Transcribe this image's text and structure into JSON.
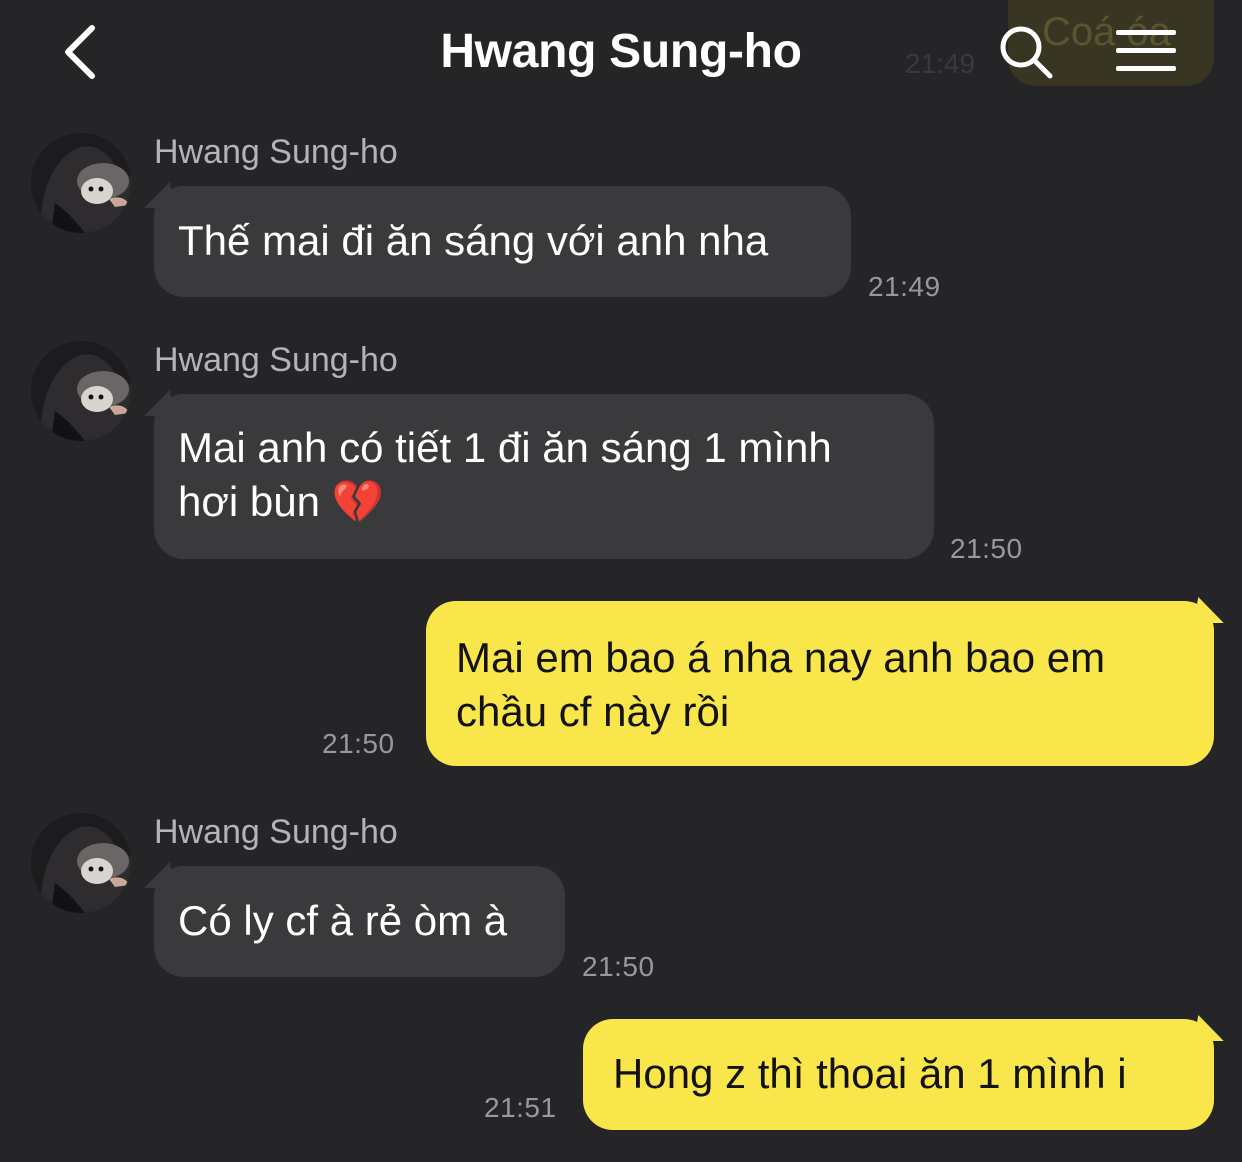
{
  "header": {
    "title": "Hwang Sung-ho"
  },
  "previous_message": {
    "text": "Coá óa",
    "time": "21:49"
  },
  "messages": [
    {
      "direction": "incoming",
      "sender": "Hwang Sung-ho",
      "text": "Thế mai đi ăn sáng với anh nha",
      "time": "21:49"
    },
    {
      "direction": "incoming",
      "sender": "Hwang Sung-ho",
      "text_line1": "Mai anh có tiết 1 đi ăn sáng 1 mình",
      "text_line2": "hơi bùn 💔",
      "time": "21:50"
    },
    {
      "direction": "outgoing",
      "text_line1": "Mai em bao á nha nay anh bao em",
      "text_line2": "chầu cf này rồi",
      "time": "21:50"
    },
    {
      "direction": "incoming",
      "sender": "Hwang Sung-ho",
      "text": "Có ly cf à rẻ òm à",
      "time": "21:50"
    },
    {
      "direction": "outgoing",
      "text": "Hong z thì thoai ăn 1 mình i",
      "time": "21:51"
    }
  ],
  "colors": {
    "background": "#252527",
    "incoming_bubble": "#3a3a3c",
    "outgoing_bubble": "#f9e64a",
    "timestamp": "#98989d",
    "sender_name": "#b4b4b8"
  },
  "icons": [
    "back-chevron-icon",
    "search-icon",
    "menu-icon",
    "avatar-photo"
  ]
}
